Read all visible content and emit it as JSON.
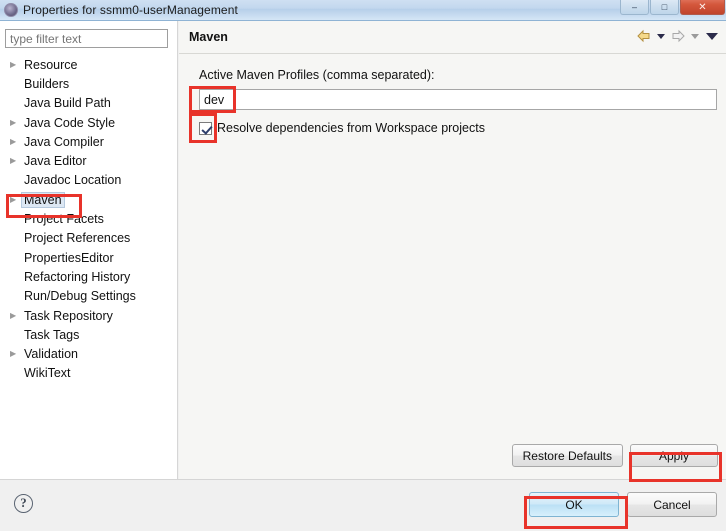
{
  "window": {
    "title": "Properties for ssmm0-userManagement",
    "icon": "eclipse-properties-icon",
    "buttons": {
      "minimize": "–",
      "maximize": "□",
      "close": "✕"
    }
  },
  "sidebar": {
    "filter": {
      "value": "",
      "placeholder": "type filter text"
    },
    "items": [
      {
        "label": "Resource",
        "expandable": true,
        "selected": false
      },
      {
        "label": "Builders",
        "expandable": false,
        "selected": false
      },
      {
        "label": "Java Build Path",
        "expandable": false,
        "selected": false
      },
      {
        "label": "Java Code Style",
        "expandable": true,
        "selected": false
      },
      {
        "label": "Java Compiler",
        "expandable": true,
        "selected": false
      },
      {
        "label": "Java Editor",
        "expandable": true,
        "selected": false
      },
      {
        "label": "Javadoc Location",
        "expandable": false,
        "selected": false
      },
      {
        "label": "Maven",
        "expandable": true,
        "selected": true
      },
      {
        "label": "Project Facets",
        "expandable": false,
        "selected": false
      },
      {
        "label": "Project References",
        "expandable": false,
        "selected": false
      },
      {
        "label": "PropertiesEditor",
        "expandable": false,
        "selected": false
      },
      {
        "label": "Refactoring History",
        "expandable": false,
        "selected": false
      },
      {
        "label": "Run/Debug Settings",
        "expandable": false,
        "selected": false
      },
      {
        "label": "Task Repository",
        "expandable": true,
        "selected": false
      },
      {
        "label": "Task Tags",
        "expandable": false,
        "selected": false
      },
      {
        "label": "Validation",
        "expandable": true,
        "selected": false
      },
      {
        "label": "WikiText",
        "expandable": false,
        "selected": false
      }
    ]
  },
  "main": {
    "title": "Maven",
    "nav": {
      "back_icon": "back-arrow-icon",
      "back_dropdown_icon": "chevron-down-icon",
      "forward_icon": "forward-arrow-icon",
      "forward_dropdown_icon": "chevron-down-icon",
      "menu_icon": "chevron-down-icon"
    },
    "profiles_label": "Active Maven Profiles (comma separated):",
    "profiles_value": "dev",
    "profiles_placeholder": "",
    "resolve_checkbox": {
      "label": "Resolve dependencies from Workspace projects",
      "checked": true
    },
    "restore_defaults_label": "Restore Defaults",
    "apply_label": "Apply"
  },
  "footer": {
    "help_icon": "help-question-icon",
    "help_glyph": "?",
    "ok_label": "OK",
    "cancel_label": "Cancel"
  },
  "colors": {
    "annotation": "#e8332a",
    "titlebar": "#c2d7ee",
    "selection": "#dce7f3",
    "default_button": "#cfe9f8"
  },
  "annotations": [
    {
      "name": "annotation-maven-tree-item"
    },
    {
      "name": "annotation-profiles-value"
    },
    {
      "name": "annotation-resolve-checkbox"
    },
    {
      "name": "annotation-apply-button"
    },
    {
      "name": "annotation-ok-button"
    }
  ]
}
